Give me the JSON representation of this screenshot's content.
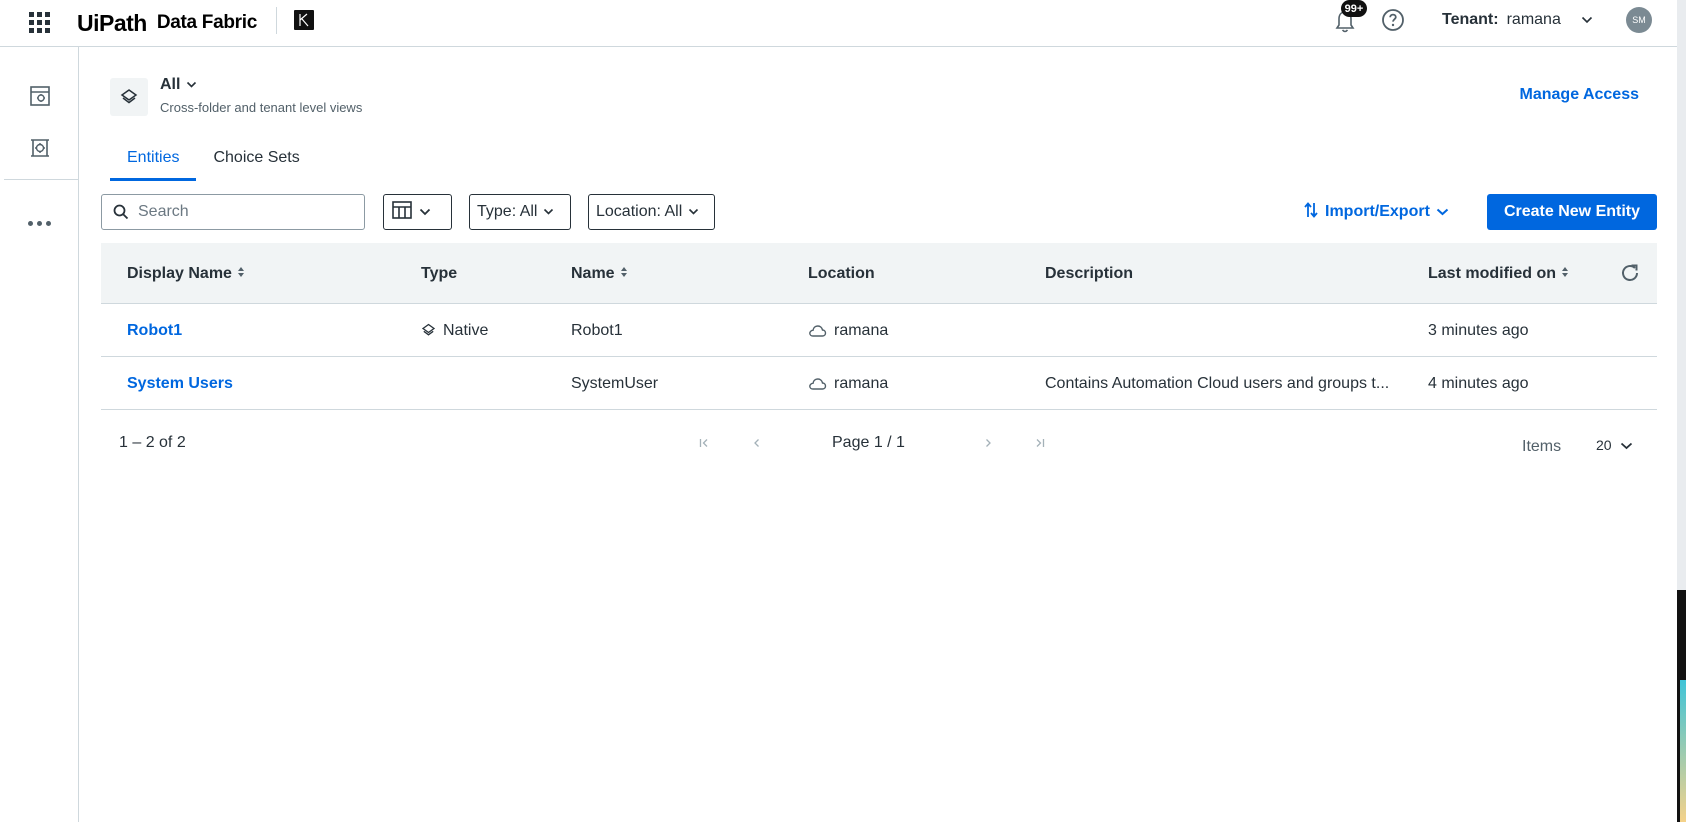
{
  "topbar": {
    "brand_logo": "UiPath",
    "product_name": "Data Fabric",
    "notifications_badge": "99+",
    "tenant_label": "Tenant:",
    "tenant_value": "ramana",
    "avatar_initials": "SM"
  },
  "header": {
    "folder_name": "All",
    "folder_description": "Cross-folder and tenant level views",
    "manage_access": "Manage Access"
  },
  "tabs": [
    {
      "label": "Entities",
      "active": true
    },
    {
      "label": "Choice Sets",
      "active": false
    }
  ],
  "toolbar": {
    "search_placeholder": "Search",
    "type_filter": "Type: All",
    "location_filter": "Location: All",
    "import_export": "Import/Export",
    "create_button": "Create New Entity"
  },
  "table": {
    "columns": [
      {
        "label": "Display Name",
        "sortable": true
      },
      {
        "label": "Type",
        "sortable": false
      },
      {
        "label": "Name",
        "sortable": true
      },
      {
        "label": "Location",
        "sortable": false
      },
      {
        "label": "Description",
        "sortable": false
      },
      {
        "label": "Last modified on",
        "sortable": true
      }
    ],
    "rows": [
      {
        "display_name": "Robot1",
        "type": "Native",
        "name": "Robot1",
        "location": "ramana",
        "description": "",
        "last_modified": "3 minutes ago"
      },
      {
        "display_name": "System Users",
        "type": "",
        "name": "SystemUser",
        "location": "ramana",
        "description": "Contains Automation Cloud users and groups t...",
        "last_modified": "4 minutes ago"
      }
    ]
  },
  "pagination": {
    "range": "1 – 2 of 2",
    "page": "Page 1 / 1",
    "items_label": "Items",
    "items_per_page": "20"
  },
  "colors": {
    "accent": "#0067df",
    "text": "#273139",
    "header_bg": "#f1f4f5",
    "border": "#cfd8dd"
  }
}
